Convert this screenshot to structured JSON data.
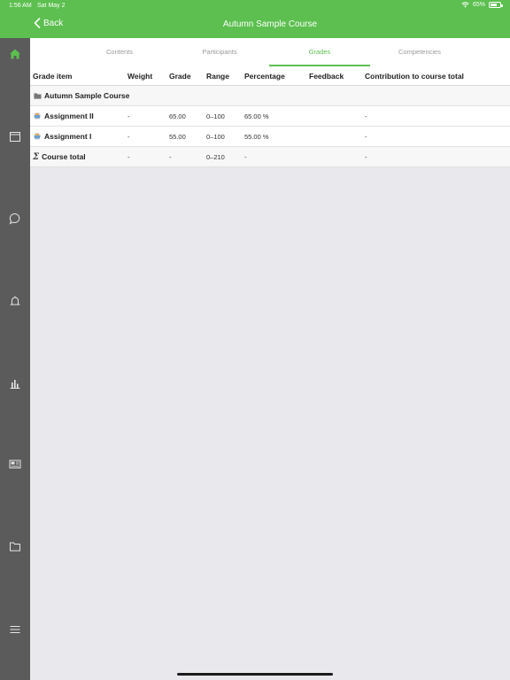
{
  "status_bar": {
    "time": "1:56 AM",
    "date": "Sat May 2",
    "battery": "65%"
  },
  "nav": {
    "back_label": "Back",
    "title": "Autumn Sample Course"
  },
  "sidebar": {
    "items": [
      {
        "name": "home-icon",
        "active": true
      },
      {
        "name": "calendar-icon"
      },
      {
        "name": "chat-icon"
      },
      {
        "name": "bell-icon"
      },
      {
        "name": "chart-icon"
      },
      {
        "name": "news-icon"
      },
      {
        "name": "folder-icon"
      },
      {
        "name": "menu-icon"
      }
    ]
  },
  "tabs": [
    {
      "label": "Contents"
    },
    {
      "label": "Participants"
    },
    {
      "label": "Grades",
      "active": true
    },
    {
      "label": "Competencies"
    }
  ],
  "table": {
    "headers": {
      "item": "Grade item",
      "weight": "Weight",
      "grade": "Grade",
      "range": "Range",
      "percentage": "Percentage",
      "feedback": "Feedback",
      "contribution": "Contribution to course total"
    },
    "category": "Autumn Sample Course",
    "rows": [
      {
        "item": "Assignment II",
        "weight": "-",
        "grade": "65.00",
        "range": "0–100",
        "percentage": "65.00 %",
        "feedback": "",
        "contribution": "-"
      },
      {
        "item": "Assignment I",
        "weight": "-",
        "grade": "55.00",
        "range": "0–100",
        "percentage": "55.00 %",
        "feedback": "",
        "contribution": "-"
      }
    ],
    "total": {
      "item": "Course total",
      "weight": "-",
      "grade": "-",
      "range": "0–210",
      "percentage": "-",
      "feedback": "",
      "contribution": "-"
    }
  },
  "colors": {
    "accent": "#5cbf4f",
    "sidebar": "#5b5b5b",
    "background": "#e9e8ec"
  }
}
